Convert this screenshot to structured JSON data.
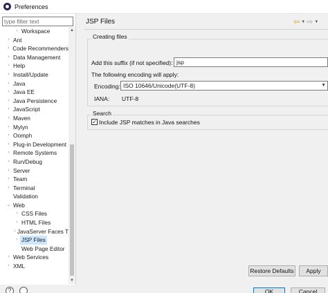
{
  "window": {
    "title": "Preferences"
  },
  "filter": {
    "placeholder": "type filter text"
  },
  "tree": [
    {
      "label": "Workspace",
      "level": 1,
      "expanded": false,
      "selected": false
    },
    {
      "label": "Ant",
      "level": 0,
      "expanded": false,
      "selected": false
    },
    {
      "label": "Code Recommenders",
      "level": 0,
      "expanded": false,
      "selected": false
    },
    {
      "label": "Data Management",
      "level": 0,
      "expanded": false,
      "selected": false
    },
    {
      "label": "Help",
      "level": 0,
      "expanded": false,
      "selected": false
    },
    {
      "label": "Install/Update",
      "level": 0,
      "expanded": false,
      "selected": false
    },
    {
      "label": "Java",
      "level": 0,
      "expanded": false,
      "selected": false
    },
    {
      "label": "Java EE",
      "level": 0,
      "expanded": false,
      "selected": false
    },
    {
      "label": "Java Persistence",
      "level": 0,
      "expanded": false,
      "selected": false
    },
    {
      "label": "JavaScript",
      "level": 0,
      "expanded": false,
      "selected": false
    },
    {
      "label": "Maven",
      "level": 0,
      "expanded": false,
      "selected": false
    },
    {
      "label": "Mylyn",
      "level": 0,
      "expanded": false,
      "selected": false
    },
    {
      "label": "Oomph",
      "level": 0,
      "expanded": false,
      "selected": false
    },
    {
      "label": "Plug-in Development",
      "level": 0,
      "expanded": false,
      "selected": false
    },
    {
      "label": "Remote Systems",
      "level": 0,
      "expanded": false,
      "selected": false
    },
    {
      "label": "Run/Debug",
      "level": 0,
      "expanded": false,
      "selected": false
    },
    {
      "label": "Server",
      "level": 0,
      "expanded": false,
      "selected": false
    },
    {
      "label": "Team",
      "level": 0,
      "expanded": false,
      "selected": false
    },
    {
      "label": "Terminal",
      "level": 0,
      "expanded": false,
      "selected": false
    },
    {
      "label": "Validation",
      "level": 0,
      "expanded": null,
      "selected": false
    },
    {
      "label": "Web",
      "level": 0,
      "expanded": true,
      "selected": false
    },
    {
      "label": "CSS Files",
      "level": 1,
      "expanded": false,
      "selected": false
    },
    {
      "label": "HTML Files",
      "level": 1,
      "expanded": false,
      "selected": false
    },
    {
      "label": "JavaServer Faces T",
      "level": 1,
      "expanded": false,
      "selected": false
    },
    {
      "label": "JSP Files",
      "level": 1,
      "expanded": false,
      "selected": true
    },
    {
      "label": "Web Page Editor",
      "level": 1,
      "expanded": null,
      "selected": false
    },
    {
      "label": "Web Services",
      "level": 0,
      "expanded": false,
      "selected": false
    },
    {
      "label": "XML",
      "level": 0,
      "expanded": false,
      "selected": false
    }
  ],
  "page": {
    "title": "JSP Files",
    "creating_files_label": "Creating files",
    "suffix_label": "Add this suffix (if not specified):",
    "suffix_value": "jsp",
    "encoding_intro": "The following encoding will apply:",
    "encoding_label": "Encoding:",
    "encoding_value": "ISO 10646/Unicode(UTF-8)",
    "iana_label": "IANA:",
    "iana_value": "UTF-8",
    "search_label": "Search",
    "include_jsp_label": "Include JSP matches in Java searches",
    "include_jsp_checked": true
  },
  "buttons": {
    "restore_defaults": "Restore Defaults",
    "apply": "Apply",
    "ok": "OK",
    "cancel": "Cancel"
  },
  "icons": {
    "back": "back-arrow-icon",
    "forward": "forward-arrow-icon",
    "help": "help-icon",
    "settings": "settings-icon"
  }
}
